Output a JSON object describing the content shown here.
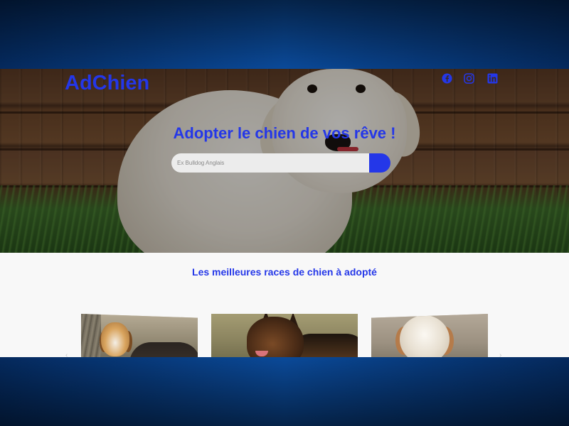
{
  "brand": {
    "name": "AdChien"
  },
  "social": [
    {
      "name": "facebook-icon"
    },
    {
      "name": "instagram-icon"
    },
    {
      "name": "linkedin-icon"
    }
  ],
  "hero": {
    "title": "Adopter le chien de vos rêve !",
    "search": {
      "placeholder": "Ex Bulldog Anglais",
      "value": ""
    }
  },
  "section": {
    "title": "Les meilleures races de chien à adopté",
    "cards": [
      {
        "name": "beagle-card"
      },
      {
        "name": "german-shepherd-card"
      },
      {
        "name": "spaniel-card"
      }
    ]
  },
  "colors": {
    "accent": "#2437e8",
    "page_bg": "#f8f8f8",
    "search_bg": "#ececec",
    "frame": "#0b4ea2"
  }
}
